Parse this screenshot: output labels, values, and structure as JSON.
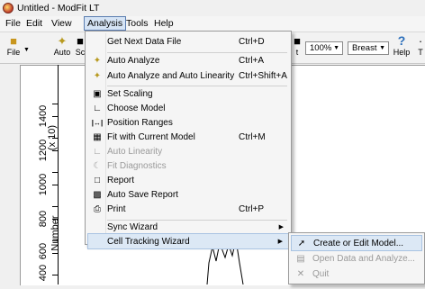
{
  "window": {
    "title": "Untitled - ModFit LT"
  },
  "menubar": {
    "items": [
      {
        "label": "File"
      },
      {
        "label": "Edit"
      },
      {
        "label": "View"
      },
      {
        "label": "Analysis"
      },
      {
        "label": "Tools"
      },
      {
        "label": "Help"
      }
    ]
  },
  "toolbar": {
    "file_label": "File",
    "auto_label": "Auto",
    "sc_label": "Sc",
    "t_label": "t",
    "zoom_value": "100%",
    "breast_value": "Breast",
    "help_label": "Help",
    "tail_label": "T"
  },
  "graph": {
    "multiplier_label": "(x 10)",
    "y_axis_title": "Number",
    "y_ticks": [
      "1400",
      "1200",
      "1000",
      "800",
      "600",
      "400"
    ]
  },
  "analysis_menu": {
    "items": [
      {
        "label": "Get Next Data File",
        "shortcut": "Ctrl+D",
        "icon": "file-next-icon"
      },
      {
        "label": "Auto Analyze",
        "shortcut": "Ctrl+A",
        "icon": "magic-wand-icon"
      },
      {
        "label": "Auto Analyze and Auto Linearity",
        "shortcut": "Ctrl+Shift+A",
        "icon": "magic-wand-icon"
      },
      {
        "label": "Set Scaling",
        "shortcut": "",
        "icon": "scaling-icon"
      },
      {
        "label": "Choose Model",
        "shortcut": "",
        "icon": "model-icon"
      },
      {
        "label": "Position Ranges",
        "shortcut": "",
        "icon": "range-icon"
      },
      {
        "label": "Fit with Current Model",
        "shortcut": "Ctrl+M",
        "icon": "fit-icon"
      },
      {
        "label": "Auto Linearity",
        "shortcut": "",
        "icon": "linearity-icon"
      },
      {
        "label": "Fit Diagnostics",
        "shortcut": "",
        "icon": "diagnostics-icon"
      },
      {
        "label": "Report",
        "shortcut": "",
        "icon": "report-icon"
      },
      {
        "label": "Auto Save Report",
        "shortcut": "",
        "icon": "save-icon"
      },
      {
        "label": "Print",
        "shortcut": "Ctrl+P",
        "icon": "printer-icon"
      },
      {
        "label": "Sync Wizard",
        "shortcut": "",
        "icon": ""
      },
      {
        "label": "Cell Tracking Wizard",
        "shortcut": "",
        "icon": ""
      }
    ]
  },
  "cell_tracking_submenu": {
    "items": [
      {
        "label": "Create or Edit Model...",
        "icon": "wand-icon"
      },
      {
        "label": "Open Data and Analyze...",
        "icon": "open-folder-icon"
      },
      {
        "label": "Quit",
        "icon": "quit-icon"
      }
    ]
  },
  "colors": {
    "menu_highlight": "#dce8f5",
    "menu_highlight_border": "#a9c3e2",
    "disabled_text": "#9a9a9a",
    "help_icon": "#2a6ebb"
  }
}
